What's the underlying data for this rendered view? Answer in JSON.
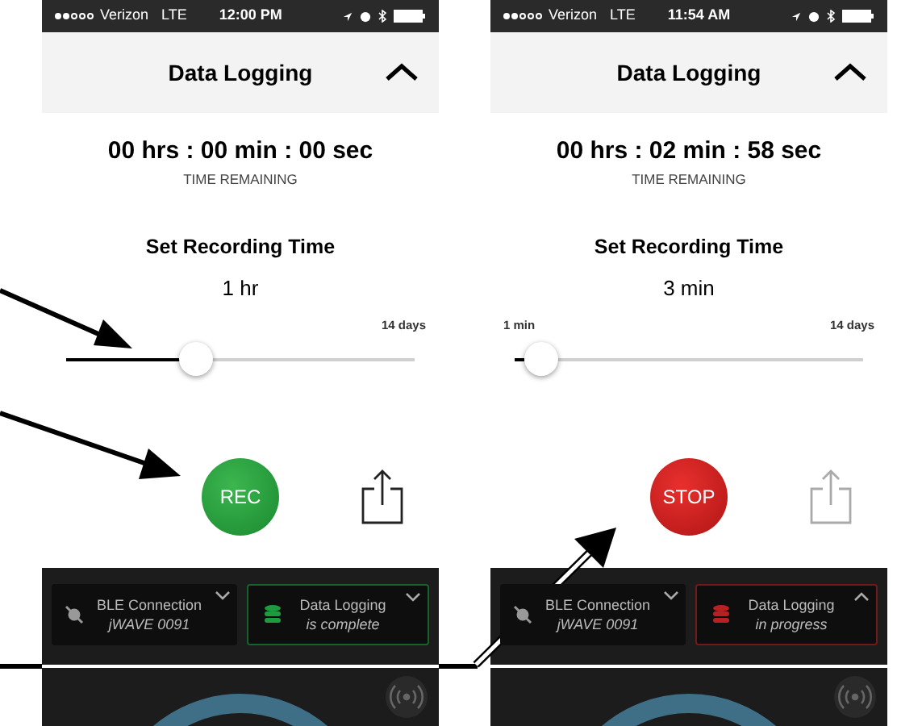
{
  "screens": [
    {
      "status_bar": {
        "carrier": "Verizon",
        "network": "LTE",
        "time": "12:00 PM"
      },
      "header": {
        "title": "Data Logging"
      },
      "timer": {
        "value": "00 hrs : 00 min : 00 sec",
        "label": "TIME REMAINING"
      },
      "recording": {
        "title": "Set Recording Time",
        "value": "1 hr",
        "max_label": "14 days",
        "level": 0.36
      },
      "record_button": {
        "label": "REC",
        "kind": "rec"
      },
      "share": {
        "disabled": false
      },
      "ble_card": {
        "title": "BLE Connection",
        "subtitle": "jWAVE 0091",
        "expanded": false
      },
      "logging_card": {
        "title": "Data Logging",
        "subtitle": "is complete",
        "color": "#1e9a3f",
        "expanded": false
      }
    },
    {
      "status_bar": {
        "carrier": "Verizon",
        "network": "LTE",
        "time": "11:54 AM"
      },
      "header": {
        "title": "Data Logging"
      },
      "timer": {
        "value": "00 hrs : 02 min : 58 sec",
        "label": "TIME REMAINING"
      },
      "recording": {
        "title": "Set Recording Time",
        "value": "3 min",
        "min_label": "1 min",
        "max_label": "14 days",
        "level": 0.03
      },
      "record_button": {
        "label": "STOP",
        "kind": "stop"
      },
      "share": {
        "disabled": true
      },
      "ble_card": {
        "title": "BLE Connection",
        "subtitle": "jWAVE 0091",
        "expanded": false
      },
      "logging_card": {
        "title": "Data Logging",
        "subtitle": "in progress",
        "color": "#b62222",
        "expanded": true
      }
    }
  ]
}
